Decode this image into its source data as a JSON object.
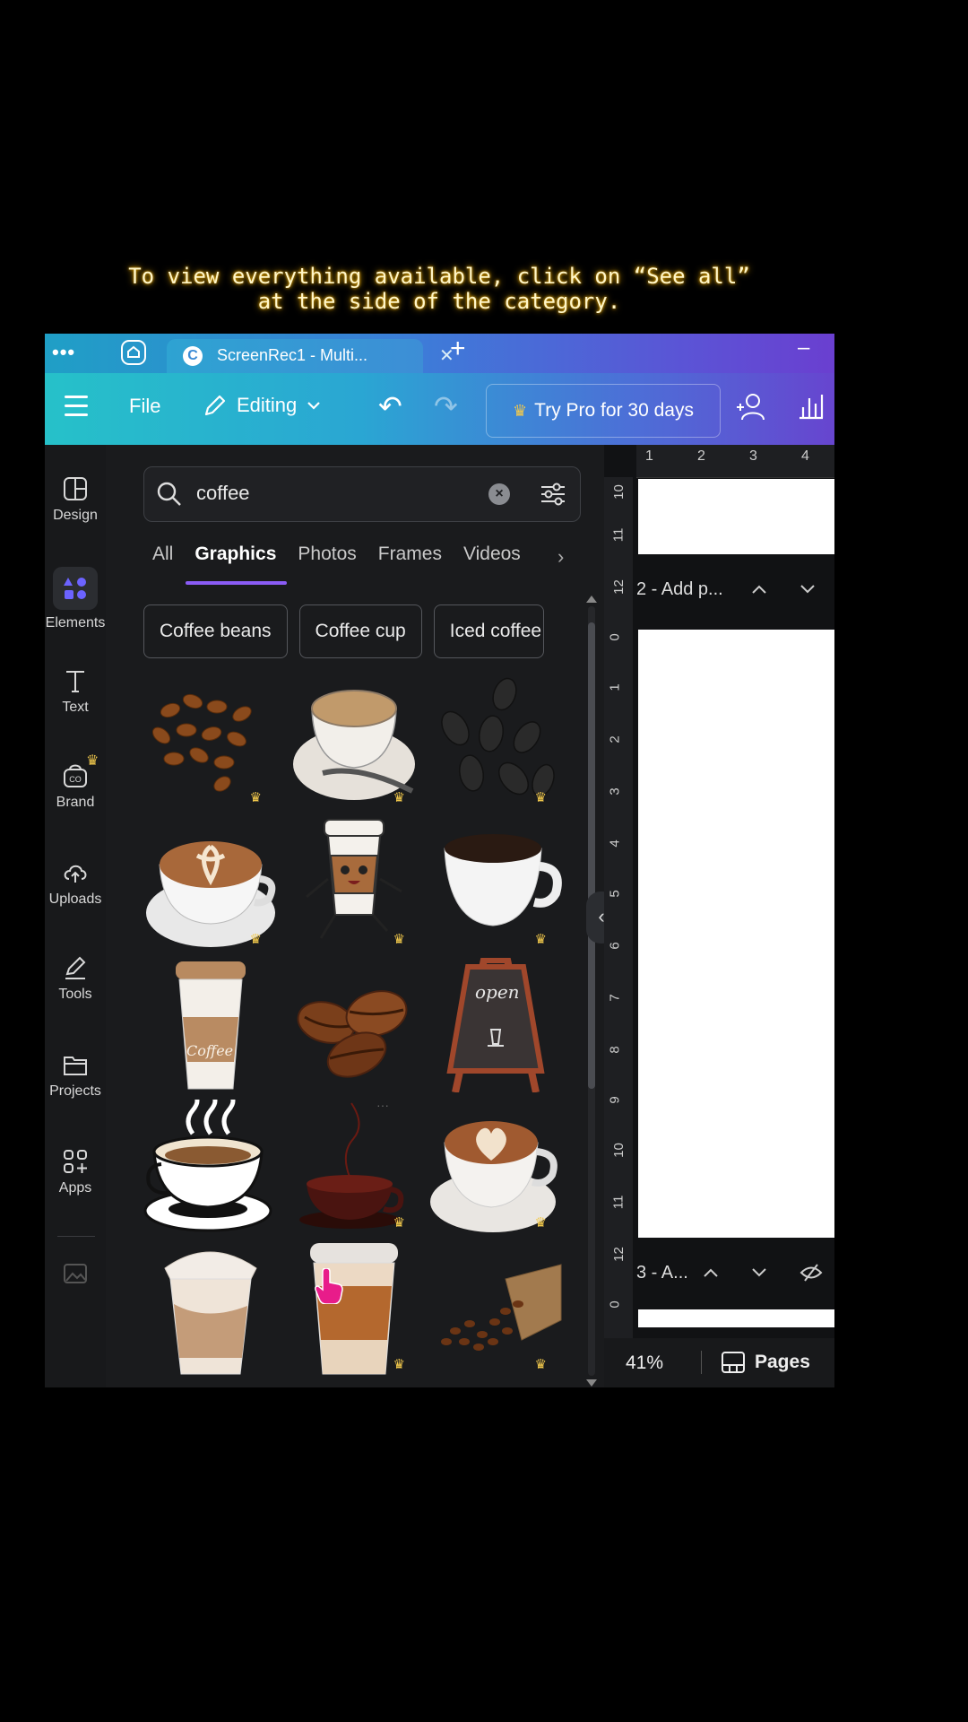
{
  "caption": {
    "line1": "To view everything available, click on “See all”",
    "line2": "at the side of the category."
  },
  "tabbar": {
    "tab_title": "ScreenRec1 - Multi...",
    "logo_letter": "C"
  },
  "toolbar": {
    "file_label": "File",
    "editing_label": "Editing",
    "pro_label": "Try Pro for 30 days"
  },
  "sidenav": [
    {
      "label": "Design",
      "icon": "design-icon"
    },
    {
      "label": "Elements",
      "icon": "elements-icon",
      "active": true
    },
    {
      "label": "Text",
      "icon": "text-icon"
    },
    {
      "label": "Brand",
      "icon": "brand-icon"
    },
    {
      "label": "Uploads",
      "icon": "uploads-icon"
    },
    {
      "label": "Tools",
      "icon": "tools-icon"
    },
    {
      "label": "Projects",
      "icon": "projects-icon"
    },
    {
      "label": "Apps",
      "icon": "apps-icon"
    }
  ],
  "search": {
    "value": "coffee"
  },
  "tabs": [
    "All",
    "Graphics",
    "Photos",
    "Frames",
    "Videos"
  ],
  "active_tab": "Graphics",
  "chips": [
    "Coffee beans",
    "Coffee cup",
    "Iced coffee"
  ],
  "graphics": [
    {
      "name": "coffee-beans-scatter",
      "premium": true
    },
    {
      "name": "coffee-cup-with-spoon",
      "premium": true
    },
    {
      "name": "coffee-beans-sketch",
      "premium": true
    },
    {
      "name": "latte-art-cup",
      "premium": true
    },
    {
      "name": "running-coffee-cup-character",
      "premium": true
    },
    {
      "name": "white-coffee-cup",
      "premium": true
    },
    {
      "name": "takeaway-coffee-cup",
      "premium": false,
      "text": "Coffee"
    },
    {
      "name": "coffee-beans-trio",
      "premium": false
    },
    {
      "name": "open-chalkboard-sign",
      "premium": false,
      "text": "open"
    },
    {
      "name": "steaming-coffee-cup",
      "premium": false
    },
    {
      "name": "dark-coffee-cup-steam",
      "premium": true
    },
    {
      "name": "latte-heart-cup",
      "premium": true
    },
    {
      "name": "iced-latte-cream",
      "premium": true
    },
    {
      "name": "iced-coffee-cup",
      "premium": true
    },
    {
      "name": "coffee-bean-sack",
      "premium": true
    }
  ],
  "canvas": {
    "ruler_top": [
      "1",
      "2",
      "3",
      "4"
    ],
    "ruler_left": [
      "10",
      "11",
      "12",
      "0",
      "1",
      "2",
      "3",
      "4",
      "5",
      "6",
      "7",
      "8",
      "9",
      "10",
      "11",
      "12",
      "0"
    ],
    "page2_label": "2 - Add p...",
    "page3_label": "3 - A...",
    "zoom": "41%",
    "pages_label": "Pages"
  },
  "colors": {
    "accent": "#8b5cf6",
    "crown": "#f2c94c",
    "toolbar_start": "#26c1c9",
    "toolbar_end": "#6745cf"
  }
}
